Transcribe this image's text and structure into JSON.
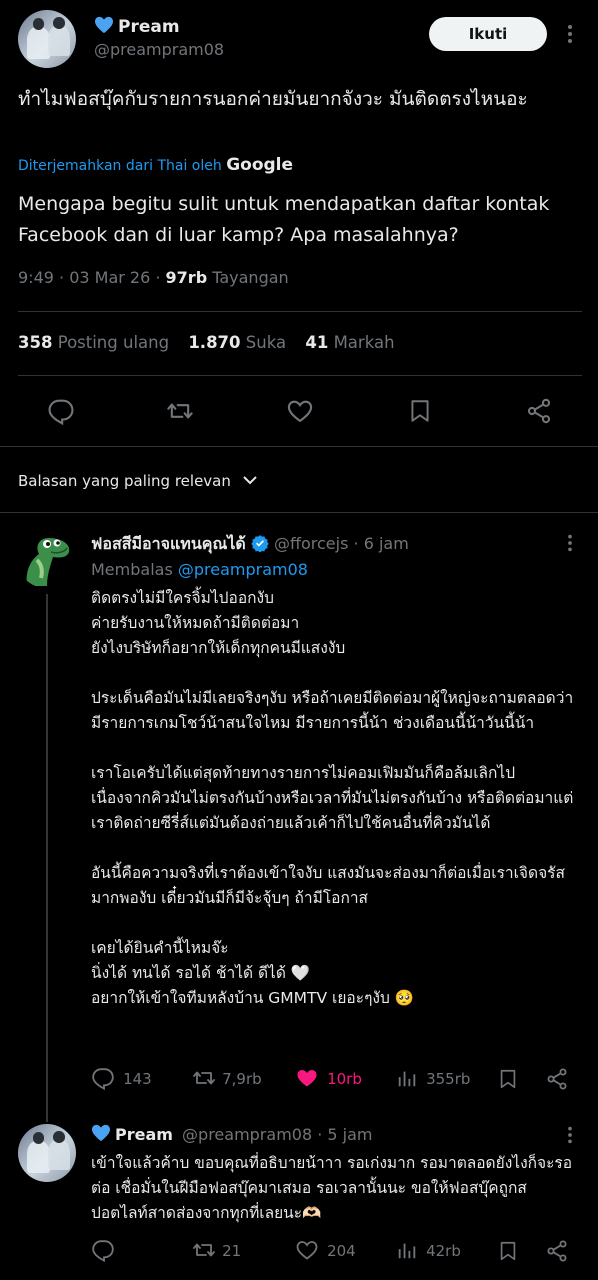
{
  "tweet": {
    "author_name": "Pream",
    "author_handle": "@preampram08",
    "follow_label": "Ikuti",
    "text": "ทำไมฟอสบุ๊คกับรายการนอกค่ายมันยากจังวะ มันติดตรงไหนอะ",
    "translated_from": "Diterjemahkan dari Thai oleh",
    "translator": "Google",
    "translation": "Mengapa begitu sulit untuk mendapatkan daftar kontak Facebook dan di luar kamp? Apa masalahnya?",
    "time": "9:49 · 03 Mar 26 · ",
    "views": "97rb",
    "views_label": " Tayangan",
    "reposts": "358",
    "reposts_label": "Posting ulang",
    "likes": "1.870",
    "likes_label": "Suka",
    "bookmarks": "41",
    "bookmarks_label": "Markah"
  },
  "sort_label": "Balasan yang paling relevan",
  "reply1": {
    "author_name": "ฟอสสีมีอาจแทนคุณได้",
    "author_handle": "@fforcejs",
    "time": "· 6 jam",
    "replying_label": "Membalas",
    "replying_to": "@preampram08",
    "text": "ติดตรงไม่มีใครจิ้มไปออกงับ\nค่ายรับงานให้หมดถ้ามีติดต่อมา\nยังไงบริษัทก็อยากให้เด็กทุกคนมีแสงงับ\n\nประเด็นคือมันไม่มีเลยจริงๆงับ หรือถ้าเคยมีติดต่อมาผู้ใหญ่จะถามตลอดว่ามีรายการเกมโชว์น้าสนใจไหม มีรายการนี้น้า ช่วงเดือนนี้น้าวันนี้น้า\n\nเราโอเครับได้แต่สุดท้ายทางรายการไม่คอมเฟิมมันก็คือล้มเลิกไป เนื่องจากคิวมันไม่ตรงกันบ้างหรือเวลาที่มันไม่ตรงกันบ้าง หรือติดต่อมาแต่เราติดถ่ายซีรี่ส์แต่มันต้องถ่ายแล้วเค้าก็ไปใช้คนอื่นที่คิวมันได้\n\nอันนี้คือความจริงที่เราต้องเข้าใจงับ แสงมันจะส่องมาก็ต่อเมื่อเราเจิดจรัสมากพองับ เดี๋ยวมันมีก็มีจ้ะจุ้บๆ ถ้ามีโอกาส\n\nเคยได้ยินคำนี้ไหมจ๊ะ\nนิ่งได้ ทนได้ รอได้ ช้าได้ ดีได้ 🤍\nอยากให้เข้าใจทีมหลังบ้าน GMMTV เยอะๆงับ 🥺",
    "replies": "143",
    "reposts": "7,9rb",
    "likes": "10rb",
    "views": "355rb"
  },
  "reply2": {
    "author_name": "Pream",
    "author_handle": "@preampram08",
    "time": "· 5 jam",
    "text": "เข้าใจแล้วค้าบ ขอบคุณที่อธิบายน้าาา รอเก่งมาก รอมาตลอดยังไงก็จะรอต่อ เชื่อมั่นในฝีมือฟอสบุ๊คมาเสมอ  รอเวลานั้นนะ ขอให้ฟอสบุ๊คถูกสปอตไลท์สาดส่องจากทุกที่เลยนะ🫶🏻",
    "replies": "",
    "reposts": "21",
    "likes": "204",
    "views": "42rb"
  },
  "colors": {
    "background": "#000000",
    "text": "#e7e9ea",
    "muted": "#71767b",
    "link": "#1d9bf0",
    "liked": "#f91880",
    "divider": "#2f3336"
  }
}
